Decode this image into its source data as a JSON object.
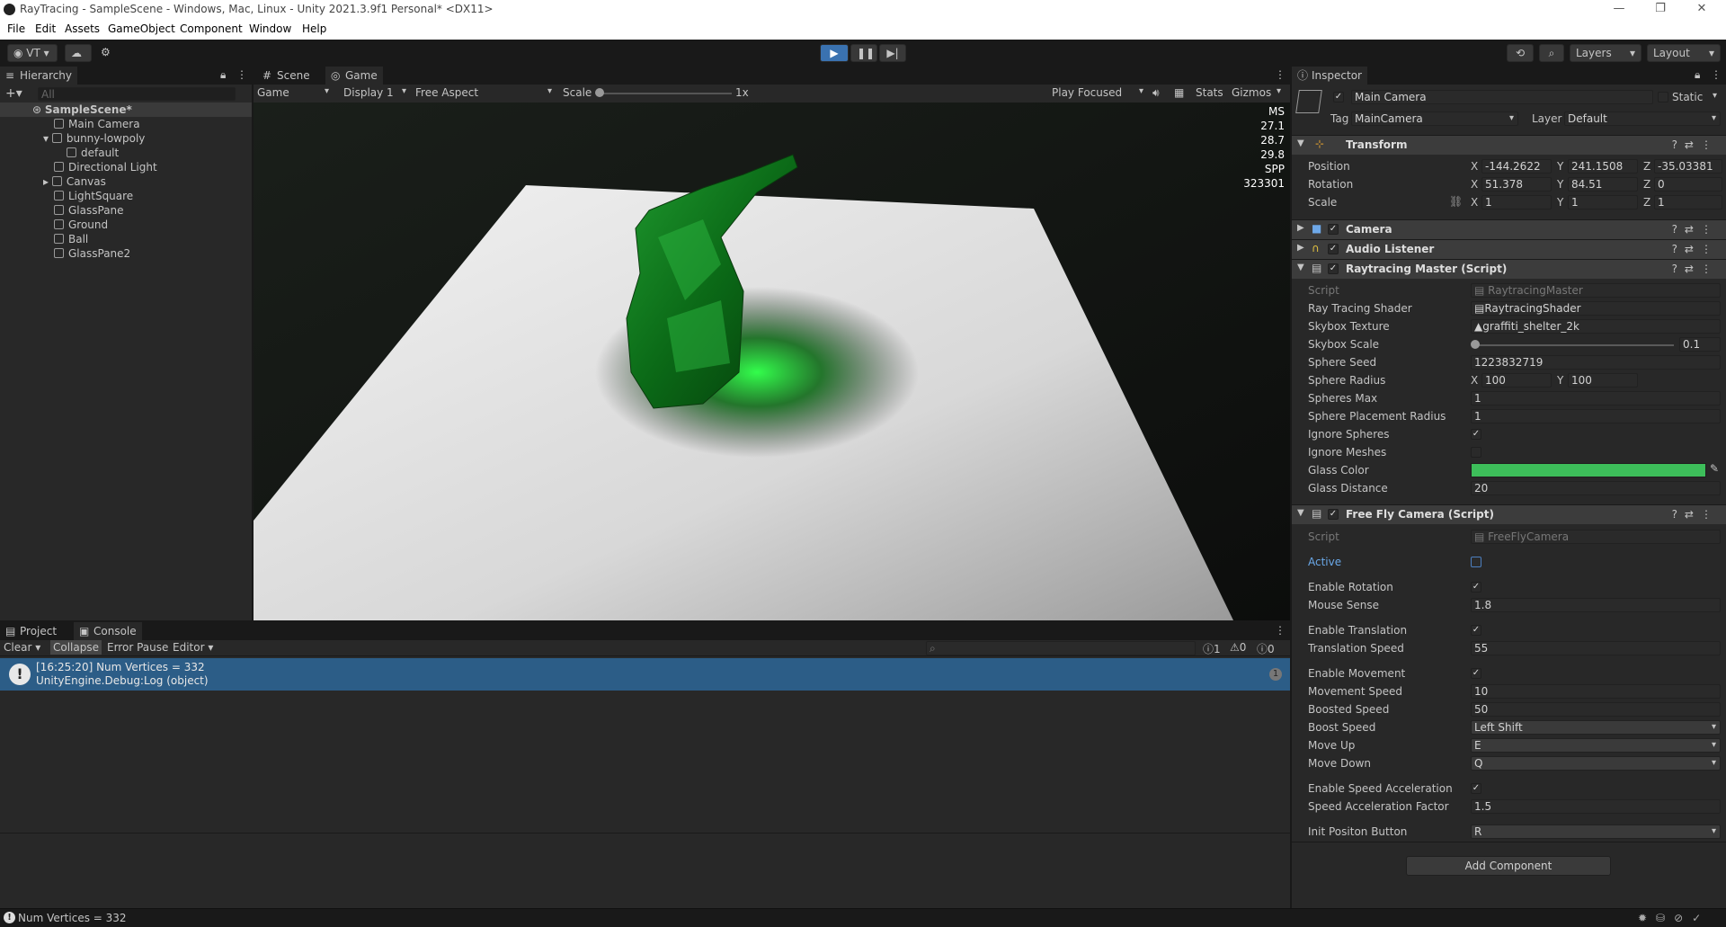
{
  "window": {
    "title": "RayTracing - SampleScene - Windows, Mac, Linux - Unity 2021.3.9f1 Personal* <DX11>",
    "minimize": "—",
    "maximize": "❐",
    "close": "✕"
  },
  "menu": [
    "File",
    "Edit",
    "Assets",
    "GameObject",
    "Component",
    "Window",
    "Help"
  ],
  "toolbar": {
    "account": "VT",
    "layers": "Layers",
    "layout": "Layout"
  },
  "hierarchy": {
    "title": "Hierarchy",
    "search_placeholder": "All",
    "items": [
      "SampleScene*",
      "Main Camera",
      "bunny-lowpoly",
      "default",
      "Directional Light",
      "Canvas",
      "LightSquare",
      "GlassPane",
      "Ground",
      "Ball",
      "GlassPane2"
    ]
  },
  "scene_tabs": {
    "scene": "Scene",
    "game": "Game"
  },
  "game_bar": {
    "view": "Game",
    "display": "Display 1",
    "aspect": "Free Aspect",
    "scale_label": "Scale",
    "scale_value": "1x",
    "play_mode": "Play Focused",
    "stats": "Stats",
    "gizmos": "Gizmos"
  },
  "overlay": [
    "MS",
    "27.1",
    "28.7",
    "29.8",
    "SPP",
    "323301"
  ],
  "console": {
    "tab_project": "Project",
    "tab_console": "Console",
    "clear": "Clear",
    "collapse": "Collapse",
    "error_pause": "Error Pause",
    "editor": "Editor",
    "count_log": "1",
    "count_warn": "0",
    "count_err": "0",
    "log_line1": "[16:25:20] Num Vertices = 332",
    "log_line2": "UnityEngine.Debug:Log (object)",
    "log_count": "1"
  },
  "status": "Num Vertices = 332",
  "inspector": {
    "title": "Inspector",
    "object_name": "Main Camera",
    "static": "Static",
    "tag_label": "Tag",
    "tag": "MainCamera",
    "layer_label": "Layer",
    "layer": "Default",
    "transform": {
      "title": "Transform",
      "position_label": "Position",
      "rotation_label": "Rotation",
      "scale_label": "Scale",
      "pos": [
        "-144.2622",
        "241.1508",
        "-35.03381"
      ],
      "rot": [
        "51.378",
        "84.51",
        "0"
      ],
      "scl": [
        "1",
        "1",
        "1"
      ]
    },
    "camera": "Camera",
    "audio": "Audio Listener",
    "rtm": {
      "title": "Raytracing Master (Script)",
      "script_label": "Script",
      "script": "RaytracingMaster",
      "shader_label": "Ray Tracing Shader",
      "shader": "RaytracingShader",
      "skybox_label": "Skybox Texture",
      "skybox": "graffiti_shelter_2k",
      "skybox_scale_label": "Skybox Scale",
      "skybox_scale": "0.1",
      "seed_label": "Sphere Seed",
      "seed": "1223832719",
      "radius_label": "Sphere Radius",
      "radius_x": "100",
      "radius_y": "100",
      "max_label": "Spheres Max",
      "max": "1",
      "placement_label": "Sphere Placement Radius",
      "placement": "1",
      "ignore_spheres_label": "Ignore Spheres",
      "ignore_meshes_label": "Ignore Meshes",
      "glass_color_label": "Glass Color",
      "glass_distance_label": "Glass Distance",
      "glass_distance": "20"
    },
    "ffc": {
      "title": "Free Fly Camera (Script)",
      "script_label": "Script",
      "script": "FreeFlyCamera",
      "active_label": "Active",
      "enable_rotation_label": "Enable Rotation",
      "mouse_sense_label": "Mouse Sense",
      "mouse_sense": "1.8",
      "enable_translation_label": "Enable Translation",
      "translation_speed_label": "Translation Speed",
      "translation_speed": "55",
      "enable_movement_label": "Enable Movement",
      "movement_speed_label": "Movement Speed",
      "movement_speed": "10",
      "boosted_speed_label": "Boosted Speed",
      "boosted_speed": "50",
      "boost_speed_label": "Boost Speed",
      "boost_speed": "Left Shift",
      "move_up_label": "Move Up",
      "move_up": "E",
      "move_down_label": "Move Down",
      "move_down": "Q",
      "esa_label": "Enable Speed Acceleration",
      "saf_label": "Speed Acceleration Factor",
      "saf": "1.5",
      "init_label": "Init Positon Button",
      "init": "R"
    },
    "add_component": "Add Component"
  },
  "colors": {
    "glass": "#3dbe5a",
    "selection": "#2c5d87",
    "accent": "#4c7fbf"
  }
}
